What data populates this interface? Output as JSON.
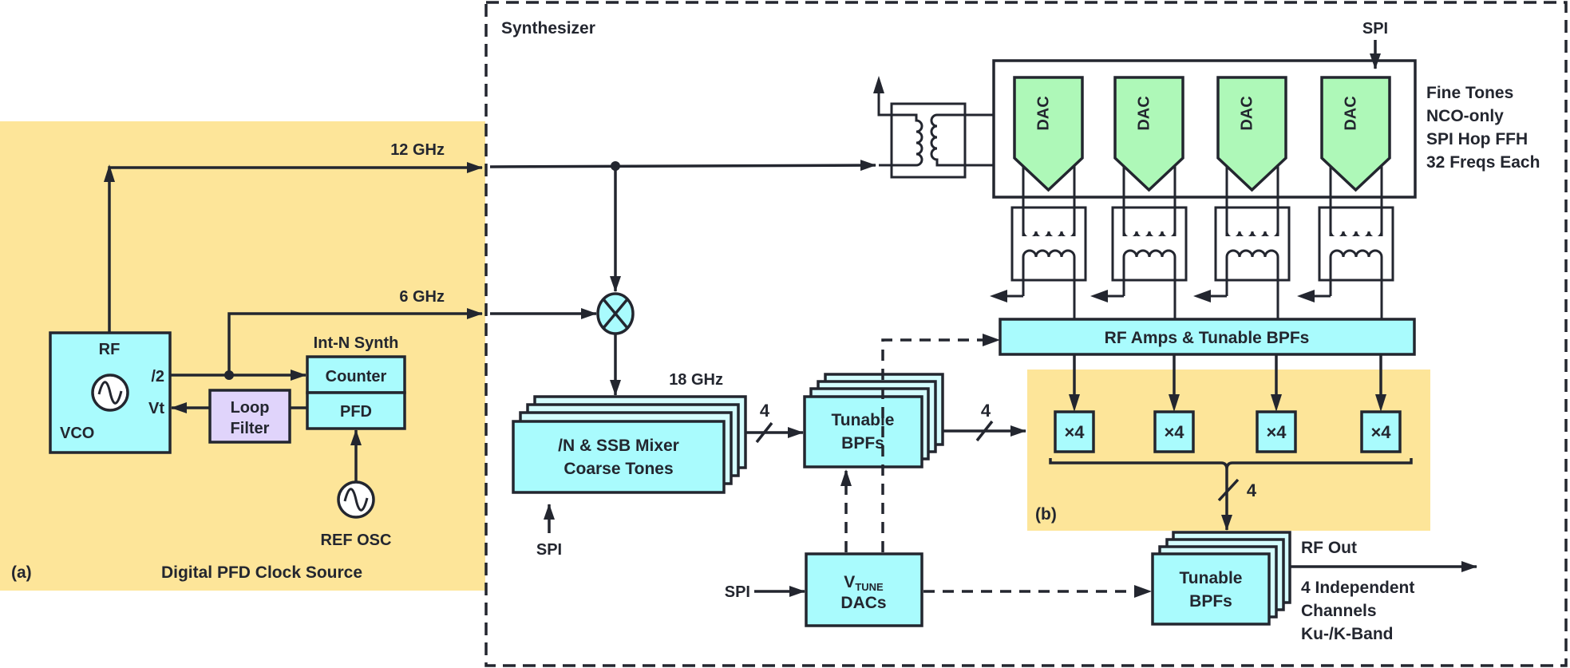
{
  "colors": {
    "stroke": "#23262f",
    "block_cyan": "#a9fbfd",
    "block_cyan_back": "#d4fdfe",
    "dac_green": "#aef8b8",
    "loop_filter_purple": "#e0d4fb",
    "region_yellow": "#fde599",
    "background": "#ffffff"
  },
  "region_a": {
    "tag": "(a)",
    "caption": "Digital PFD Clock Source",
    "vco": {
      "top_label": "RF",
      "div_label": "/2",
      "tune_label": "Vt",
      "name": "VCO",
      "icon": "sine-oscillator-icon"
    },
    "loop_filter": {
      "line1": "Loop",
      "line2": "Filter"
    },
    "int_n": {
      "title": "Int-N Synth",
      "counter": "Counter",
      "pfd": "PFD"
    },
    "ref_osc": {
      "label": "REF OSC",
      "icon": "sine-oscillator-icon"
    },
    "freq_12": "12 GHz",
    "freq_6": "6 GHz"
  },
  "synth": {
    "title": "Synthesizer",
    "mixer_icon": "mixer-icon",
    "freq_18": "18 GHz",
    "coarse": {
      "line1": "/N & SSB Mixer",
      "line2": "Coarse Tones",
      "spi": "SPI"
    },
    "bus_label": "4",
    "mid_bpf": {
      "line1": "Tunable",
      "line2": "BPFs"
    },
    "vtune": {
      "v": "V",
      "sub": "TUNE",
      "line2": "DACs",
      "spi": "SPI"
    },
    "dac_bank": {
      "spi": "SPI",
      "dac_label": "DAC",
      "dac_count": 4,
      "notes": [
        "Fine Tones",
        "NCO-only",
        "SPI Hop FFH",
        "32 Freqs Each"
      ]
    },
    "rf_amps": "RF Amps & Tunable BPFs",
    "region_b": {
      "tag": "(b)",
      "multiplier": "×4",
      "bus_label": "4"
    },
    "out_bpf": {
      "line1": "Tunable",
      "line2": "BPFs"
    },
    "rf_out": {
      "title": "RF Out",
      "notes": [
        "4 Independent",
        "Channels",
        "Ku-/K-Band"
      ]
    }
  }
}
